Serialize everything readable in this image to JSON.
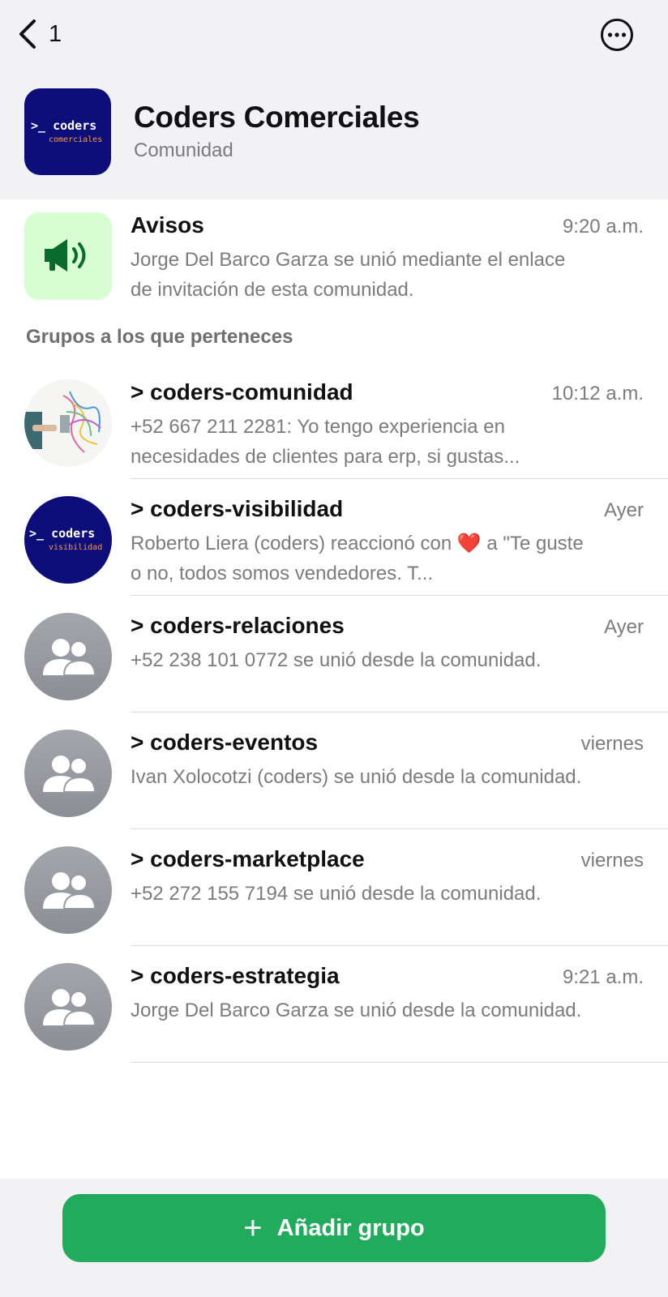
{
  "topbar": {
    "back_count": "1",
    "back_icon": "chevron-left-icon",
    "more_icon": "more-horizontal-circle-icon"
  },
  "community": {
    "name": "Coders Comerciales",
    "subtitle": "Comunidad",
    "logo_text": "coders",
    "logo_subtext": "comerciales"
  },
  "announcements": {
    "title": "Avisos",
    "time": "9:20 a.m.",
    "message": "Jorge  Del Barco Garza se unió mediante el enlace de invitación de esta comunidad.",
    "icon": "megaphone-icon"
  },
  "section_label": "Grupos a los que perteneces",
  "groups": [
    {
      "title": "> coders-comunidad",
      "time": "10:12 a.m.",
      "message": "+52 667 211 2281: Yo tengo experiencia en necesidades de clientes para erp, si gustas..."
    },
    {
      "title": "> coders-visibilidad",
      "time": "Ayer",
      "message": "Roberto Liera (coders) reaccionó con ❤️ a \"Te guste o no, todos somos vendedores. T...",
      "logo_text": "coders",
      "logo_subtext": "visibilidad"
    },
    {
      "title": "> coders-relaciones",
      "time": "Ayer",
      "message": "+52 238 101 0772 se unió desde la comunidad."
    },
    {
      "title": "> coders-eventos",
      "time": "viernes",
      "message": "Ivan Xolocotzi  (coders) se unió desde la comunidad."
    },
    {
      "title": "> coders-marketplace",
      "time": "viernes",
      "message": "+52 272 155 7194 se unió desde la comunidad."
    },
    {
      "title": "> coders-estrategia",
      "time": "9:21 a.m.",
      "message": "Jorge  Del Barco Garza se unió desde la comunidad."
    }
  ],
  "footer": {
    "add_label": "Añadir grupo",
    "add_symbol": "+"
  },
  "colors": {
    "accent": "#21ac5d",
    "community_navy": "#0e0e7a",
    "megaphone_green": "#0a6b2f",
    "avisos_bg": "#d8fdd2"
  }
}
